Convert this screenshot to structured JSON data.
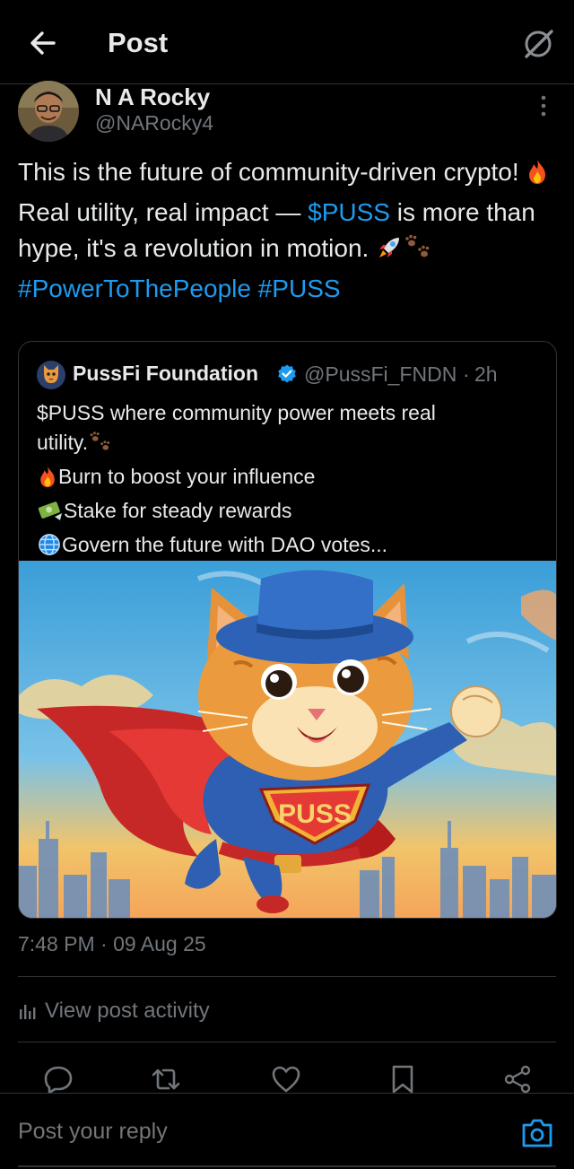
{
  "header": {
    "title": "Post"
  },
  "post": {
    "author_name": "N A Rocky",
    "author_handle": "@NARocky4",
    "text": {
      "part1": "This is the future of community-driven crypto!",
      "part2": "Real utility, real impact —",
      "cashtag": "$PUSS",
      "part3": "is more than hype, it's a revolution in motion.",
      "hashtag1": "#PowerToThePeople",
      "hashtag2": "#PUSS"
    },
    "timestamp": "7:48 PM · 09 Aug 25"
  },
  "quoted_post": {
    "author_name": "PussFi Foundation",
    "author_handle": "@PussFi_FNDN",
    "separator": "·",
    "time": "2h",
    "lines": {
      "line1": "$PUSS where community power meets real",
      "line2": "utility.",
      "line3": "Burn to boost your influence",
      "line4": "Stake for steady rewards",
      "line5": "Govern the future with DAO votes..."
    },
    "image_text": "PUSS"
  },
  "activity": {
    "label": "View post activity"
  },
  "actions": [
    "reply-icon",
    "repost-icon",
    "like-icon",
    "bookmark-icon",
    "share-icon"
  ],
  "reply": {
    "placeholder": "Post your reply"
  },
  "colors": {
    "background": "#000000",
    "text": "#e7e9ea",
    "secondary": "#71767b",
    "link": "#1d9bf0",
    "border": "#2f3336"
  }
}
